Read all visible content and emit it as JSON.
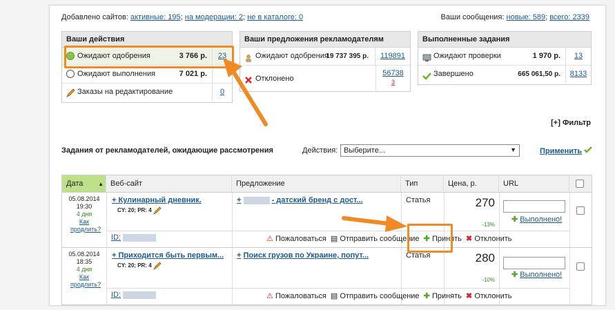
{
  "topbar": {
    "added_label": "Добавлено сайтов:",
    "active_label": "активные: 195",
    "moderation_label": "на модерации: 2",
    "catalog_label": "не в каталоге: 0",
    "messages_label": "Ваши сообщения:",
    "new_label": "новые: 589",
    "all_label": "всего: 2339"
  },
  "actions": {
    "title": "Ваши действия",
    "rows": [
      {
        "label": "Ожидают одобрения",
        "value": "3 766 р.",
        "count": "23"
      },
      {
        "label": "Ожидают выполнения",
        "value": "7 021 р.",
        "count": ""
      },
      {
        "label": "Заказы на редактирование",
        "value": "",
        "count": "0"
      }
    ]
  },
  "offers": {
    "title": "Ваши предложения рекламодателям",
    "rows": [
      {
        "label": "Ожидают одобрения",
        "value": "19 737 395 р.",
        "count": "119891"
      },
      {
        "label": "Отклонено",
        "value": "",
        "count": "56738",
        "sub": "3"
      }
    ]
  },
  "done": {
    "title": "Выполненные задания",
    "rows": [
      {
        "label": "Ожидают проверки",
        "value": "1 970 р.",
        "count": "13"
      },
      {
        "label": "Завершено",
        "value": "665 061,50 р.",
        "count": "8133"
      }
    ]
  },
  "filter_label": "[+] Фильтр",
  "section_title": "Задания от рекламодателей, ожидающие рассмотрения",
  "actions_select": {
    "label": "Действия:",
    "value": "Выберите..."
  },
  "apply_label": "Применить",
  "table": {
    "headers": {
      "date": "Дата",
      "site": "Веб-сайт",
      "offer": "Предложение",
      "type": "Тип",
      "price": "Цена, р.",
      "url": "URL"
    },
    "rows": [
      {
        "date": "05.08.2014",
        "time": "19:30",
        "days": "4 дня",
        "extend": "Как продлить?",
        "site": "+ Кулинарный дневник.",
        "metrics": "CY: 20; PR: 4",
        "offer_prefix": "+",
        "offer_text": "- датский бренд с дост...",
        "type": "Статья",
        "price": "270",
        "percent": "-13%",
        "done_label": "Выполнено!",
        "id_label": "ID:"
      },
      {
        "date": "05.08.2014",
        "time": "18:35",
        "days": "4 дня",
        "extend": "Как продлить?",
        "site": "+ Приходится быть первым...",
        "metrics": "CY: 20; PR: 4",
        "offer_prefix": "+",
        "offer_text": "Поиск грузов по Украине, попут...",
        "type": "Статья",
        "price": "280",
        "percent": "-10%",
        "done_label": "Выполнено!",
        "id_label": "ID:"
      }
    ],
    "row_actions": {
      "complain": "Пожаловаться",
      "send": "Отправить сообщение",
      "accept": "Принять",
      "reject": "Отклонить"
    }
  },
  "colors": {
    "accent_orange": "#f08a24",
    "date_header": "#bfe08a",
    "link": "#1a5a96"
  }
}
